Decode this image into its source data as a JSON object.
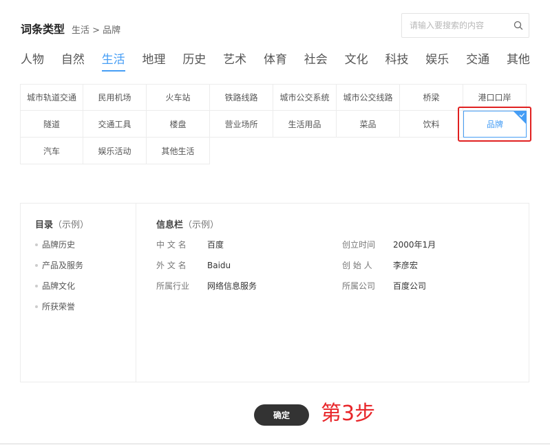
{
  "header": {
    "title": "词条类型",
    "breadcrumb": "生活 > 品牌"
  },
  "search": {
    "placeholder": "请输入要搜索的内容",
    "value": ""
  },
  "tabs": [
    {
      "label": "人物",
      "active": false
    },
    {
      "label": "自然",
      "active": false
    },
    {
      "label": "生活",
      "active": true
    },
    {
      "label": "地理",
      "active": false
    },
    {
      "label": "历史",
      "active": false
    },
    {
      "label": "艺术",
      "active": false
    },
    {
      "label": "体育",
      "active": false
    },
    {
      "label": "社会",
      "active": false
    },
    {
      "label": "文化",
      "active": false
    },
    {
      "label": "科技",
      "active": false
    },
    {
      "label": "娱乐",
      "active": false
    },
    {
      "label": "交通",
      "active": false
    },
    {
      "label": "其他",
      "active": false
    }
  ],
  "subcategories": {
    "rows": [
      [
        "城市轨道交通",
        "民用机场",
        "火车站",
        "铁路线路",
        "城市公交系统",
        "城市公交线路",
        "桥梁",
        "港口口岸"
      ],
      [
        "隧道",
        "交通工具",
        "楼盘",
        "营业场所",
        "生活用品",
        "菜品",
        "饮料",
        "品牌"
      ],
      [
        "汽车",
        "娱乐活动",
        "其他生活"
      ]
    ],
    "selected": "品牌"
  },
  "toc": {
    "title": "目录",
    "title_note": "（示例）",
    "items": [
      "品牌历史",
      "产品及服务",
      "品牌文化",
      "所获荣誉"
    ]
  },
  "info": {
    "title": "信息栏",
    "title_note": "（示例）",
    "fields": [
      {
        "key": "中 文 名",
        "value": "百度"
      },
      {
        "key": "创立时间",
        "value": "2000年1月"
      },
      {
        "key": "外 文 名",
        "value": "Baidu"
      },
      {
        "key": "创 始 人",
        "value": "李彦宏"
      },
      {
        "key": "所属行业",
        "value": "网络信息服务"
      },
      {
        "key": "所属公司",
        "value": "百度公司"
      }
    ]
  },
  "actions": {
    "confirm_label": "确定"
  },
  "annotation": {
    "step_label": "第3步"
  },
  "colors": {
    "accent": "#459df5",
    "highlight": "#e02020",
    "step_text": "#e8262a",
    "button_bg": "#333333"
  }
}
